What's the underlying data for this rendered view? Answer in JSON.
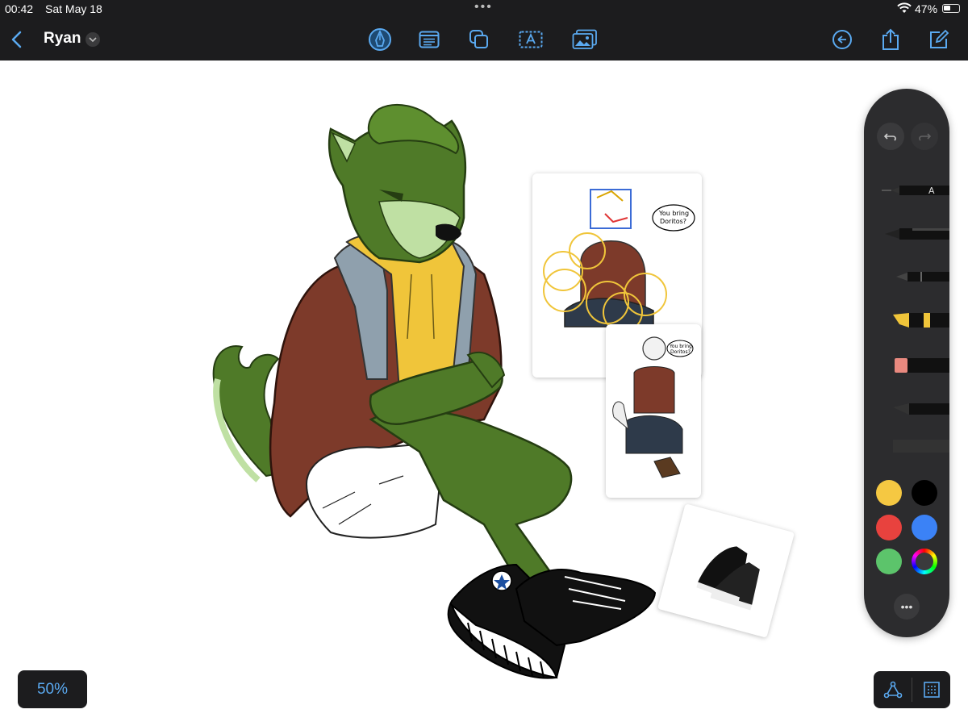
{
  "status": {
    "time": "00:42",
    "date": "Sat May 18",
    "battery": "47%",
    "battery_level": 0.47
  },
  "header": {
    "title": "Ryan",
    "tools": [
      "pen-tool-icon",
      "text-block-icon",
      "shapes-icon",
      "text-box-icon",
      "image-icon"
    ],
    "right": [
      "history-icon",
      "share-icon",
      "compose-icon"
    ]
  },
  "canvas": {
    "reference_bubble_1": [
      "You bring",
      "Doritos?"
    ],
    "reference_bubble_2": [
      "You bring",
      "Doritos?"
    ]
  },
  "palette": {
    "tools": [
      "marker-pen",
      "fineliner-pen",
      "pencil",
      "highlighter",
      "eraser",
      "crayon"
    ],
    "colors": [
      "#f5c842",
      "#000000",
      "#e8423e",
      "#3b82f6",
      "#5cc46b",
      "color-wheel"
    ],
    "more_label": "•••"
  },
  "zoom": {
    "label": "50%"
  },
  "bottom_tools": [
    "lasso-icon",
    "grid-icon"
  ],
  "colors": {
    "accent": "#5aa9f0",
    "toolbar_bg": "#1c1c1e",
    "wolf_fur": "#4f7a28",
    "wolf_light": "#bfe0a3",
    "jacket": "#7d3a2a",
    "hoodie": "#f0c53a"
  }
}
